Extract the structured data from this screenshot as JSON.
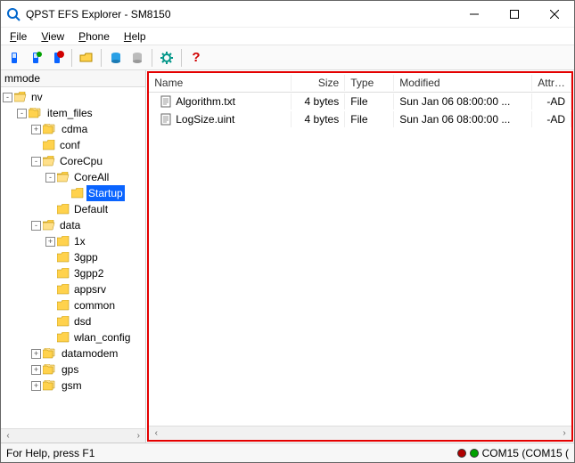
{
  "title": "QPST EFS Explorer - SM8150",
  "menus": [
    "File",
    "View",
    "Phone",
    "Help"
  ],
  "toolbar_icons": [
    "phone-icon",
    "phone-connect-icon",
    "phone-stop-icon",
    "folder-open-icon",
    "db-blue-icon",
    "db-grey-icon",
    "gear-icon",
    "help-icon"
  ],
  "tree_root": "mmode",
  "tree": [
    {
      "depth": 0,
      "exp": "-",
      "icon": "folder-open",
      "label": "nv"
    },
    {
      "depth": 1,
      "exp": "-",
      "icon": "multi-folder",
      "label": "item_files"
    },
    {
      "depth": 2,
      "exp": "+",
      "icon": "multi-folder",
      "label": "cdma"
    },
    {
      "depth": 2,
      "exp": "",
      "icon": "folder",
      "label": "conf"
    },
    {
      "depth": 2,
      "exp": "-",
      "icon": "folder-open",
      "label": "CoreCpu"
    },
    {
      "depth": 3,
      "exp": "-",
      "icon": "folder-open",
      "label": "CoreAll"
    },
    {
      "depth": 4,
      "exp": "",
      "icon": "folder",
      "label": "Startup",
      "selected": true
    },
    {
      "depth": 3,
      "exp": "",
      "icon": "folder",
      "label": "Default"
    },
    {
      "depth": 2,
      "exp": "-",
      "icon": "folder-open",
      "label": "data"
    },
    {
      "depth": 3,
      "exp": "+",
      "icon": "folder",
      "label": "1x"
    },
    {
      "depth": 3,
      "exp": "",
      "icon": "folder",
      "label": "3gpp"
    },
    {
      "depth": 3,
      "exp": "",
      "icon": "folder",
      "label": "3gpp2"
    },
    {
      "depth": 3,
      "exp": "",
      "icon": "folder",
      "label": "appsrv"
    },
    {
      "depth": 3,
      "exp": "",
      "icon": "folder",
      "label": "common"
    },
    {
      "depth": 3,
      "exp": "",
      "icon": "folder",
      "label": "dsd"
    },
    {
      "depth": 3,
      "exp": "",
      "icon": "folder",
      "label": "wlan_config"
    },
    {
      "depth": 2,
      "exp": "+",
      "icon": "multi-folder",
      "label": "datamodem"
    },
    {
      "depth": 2,
      "exp": "+",
      "icon": "multi-folder",
      "label": "gps"
    },
    {
      "depth": 2,
      "exp": "+",
      "icon": "multi-folder",
      "label": "gsm"
    }
  ],
  "columns": {
    "name": "Name",
    "size": "Size",
    "type": "Type",
    "modified": "Modified",
    "attr": "Attribu..."
  },
  "files": [
    {
      "name": "Algorithm.txt",
      "size": "4 bytes",
      "type": "File",
      "modified": "Sun Jan 06 08:00:00 ...",
      "attr": "-AD"
    },
    {
      "name": "LogSize.uint",
      "size": "4 bytes",
      "type": "File",
      "modified": "Sun Jan 06 08:00:00 ...",
      "attr": "-AD"
    }
  ],
  "status_left": "For Help, press F1",
  "status_port": "COM15 (COM15 ("
}
